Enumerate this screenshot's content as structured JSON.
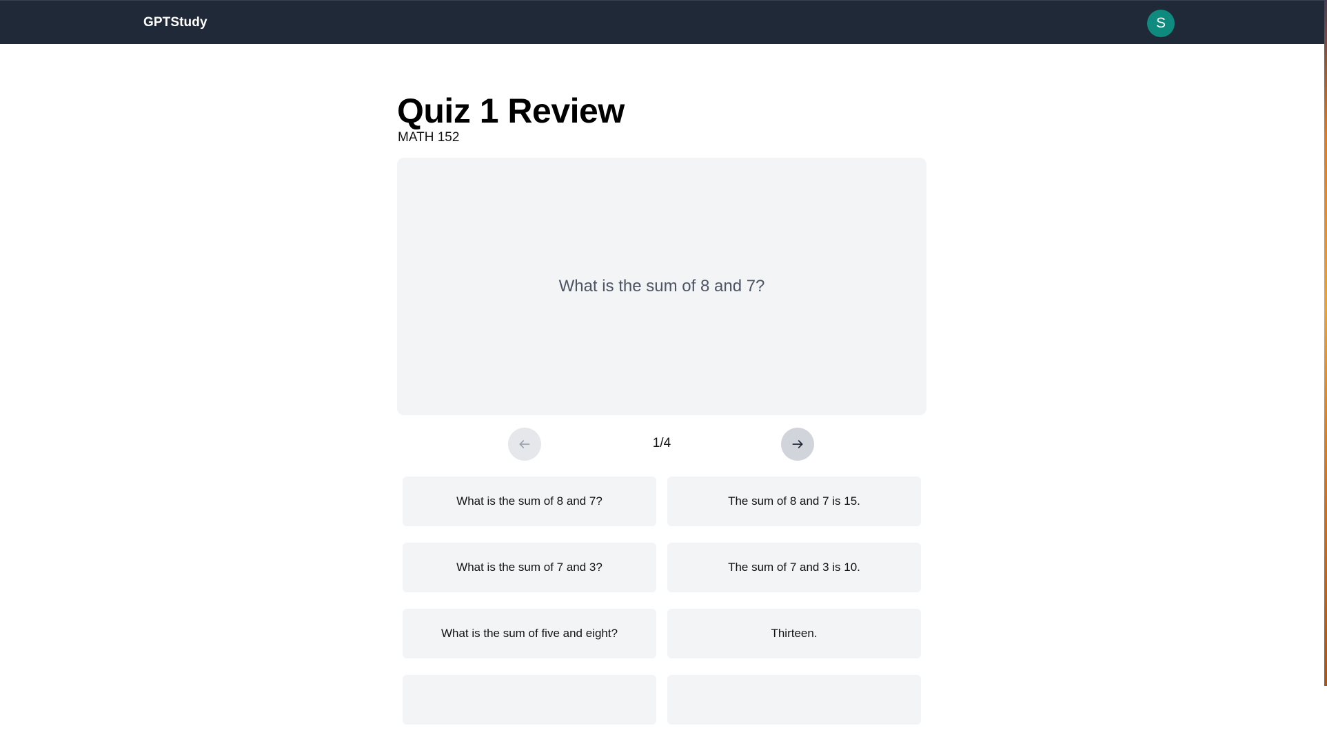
{
  "navbar": {
    "brand": "GPTStudy",
    "avatar_initial": "S",
    "avatar_color": "#0f8a7e"
  },
  "header": {
    "title": "Quiz 1 Review",
    "course": "MATH 152"
  },
  "flashcard": {
    "current_text": "What is the sum of 8 and 7?"
  },
  "navigation": {
    "prev_icon": "arrow-left-icon",
    "next_icon": "arrow-right-icon",
    "counter": "1/4"
  },
  "cards": [
    {
      "term": "What is the sum of 8 and 7?",
      "definition": "The sum of 8 and 7 is 15."
    },
    {
      "term": "What is the sum of 7 and 3?",
      "definition": "The sum of 7 and 3 is 10."
    },
    {
      "term": "What is the sum of five and eight?",
      "definition": "Thirteen."
    },
    {
      "term": "",
      "definition": ""
    }
  ]
}
